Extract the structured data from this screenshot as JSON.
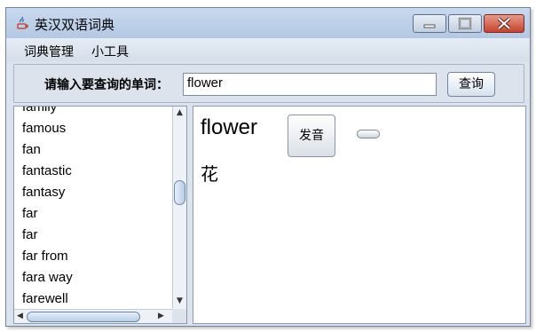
{
  "window": {
    "title": "英汉双语词典"
  },
  "menu": [
    {
      "label": "词典管理"
    },
    {
      "label": "小工具"
    }
  ],
  "search": {
    "prompt": "请输入要查询的单词：",
    "value": "flower",
    "button_label": "查询"
  },
  "word_list": {
    "items": [
      "family",
      "famous",
      "fan",
      "fantastic",
      "fantasy",
      "far",
      "far",
      "far from",
      "fara way",
      "farewell"
    ],
    "vertical_scroll_position": 0.4
  },
  "detail": {
    "word": "flower",
    "pronounce_label": "发音",
    "meaning": "花"
  },
  "icons": [
    "java-app-icon",
    "minimize-icon",
    "maximize-icon",
    "close-icon",
    "scroll-up-icon",
    "scroll-down-icon",
    "scroll-left-icon",
    "scroll-right-icon"
  ]
}
